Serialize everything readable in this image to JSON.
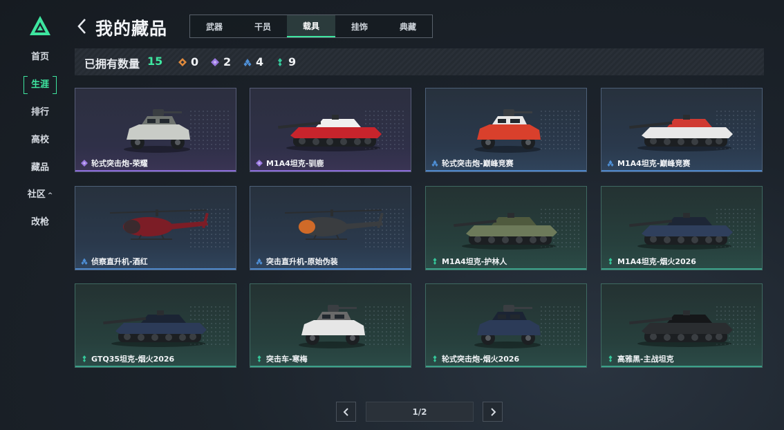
{
  "sidebar": {
    "logo": "game-logo",
    "items": [
      {
        "label": "首页",
        "active": false
      },
      {
        "label": "生涯",
        "active": true
      },
      {
        "label": "排行",
        "active": false
      },
      {
        "label": "高校",
        "active": false
      },
      {
        "label": "藏品",
        "active": false
      },
      {
        "label": "社区",
        "active": false,
        "caret": "^"
      },
      {
        "label": "改枪",
        "active": false
      }
    ]
  },
  "header": {
    "title": "我的藏品",
    "tabs": [
      {
        "label": "武器",
        "active": false
      },
      {
        "label": "干员",
        "active": false
      },
      {
        "label": "载具",
        "active": true
      },
      {
        "label": "挂饰",
        "active": false
      },
      {
        "label": "典藏",
        "active": false
      }
    ]
  },
  "summary": {
    "label": "已拥有数量",
    "total": "15",
    "rarities": [
      {
        "icon": "orange-diamond-icon",
        "color": "#e08a3c",
        "count": "0"
      },
      {
        "icon": "purple-diamond-icon",
        "color": "#9a78e0",
        "count": "2"
      },
      {
        "icon": "blue-diamond-icon",
        "color": "#4e8fd6",
        "count": "4"
      },
      {
        "icon": "green-diamond-icon",
        "color": "#35c79a",
        "count": "9"
      }
    ]
  },
  "cards": [
    {
      "name": "轮式突击炮-荣耀",
      "rarity": "purple",
      "vehicle": "armored-car"
    },
    {
      "name": "M1A4坦克-驯鹿",
      "rarity": "purple",
      "vehicle": "tank"
    },
    {
      "name": "轮式突击炮-巅峰竞赛",
      "rarity": "blue",
      "vehicle": "armored-car"
    },
    {
      "name": "M1A4坦克-巅峰竞赛",
      "rarity": "blue",
      "vehicle": "tank"
    },
    {
      "name": "侦察直升机-酒红",
      "rarity": "blue",
      "vehicle": "helicopter"
    },
    {
      "name": "突击直升机-原始伪装",
      "rarity": "blue",
      "vehicle": "helicopter"
    },
    {
      "name": "M1A4坦克-护林人",
      "rarity": "green",
      "vehicle": "tank"
    },
    {
      "name": "M1A4坦克-烟火2026",
      "rarity": "green",
      "vehicle": "tank"
    },
    {
      "name": "GTQ35坦克-烟火2026",
      "rarity": "green",
      "vehicle": "tank"
    },
    {
      "name": "突击车-寒梅",
      "rarity": "green",
      "vehicle": "armored-car"
    },
    {
      "name": "轮式突击炮-烟火2026",
      "rarity": "green",
      "vehicle": "armored-car"
    },
    {
      "name": "高雅黑-主战坦克",
      "rarity": "green",
      "vehicle": "tank"
    }
  ],
  "colors": {
    "accent": "#3ee6a0",
    "purple": "#9a78e0",
    "blue": "#4e8fd6",
    "green": "#35c79a",
    "orange": "#e08a3c"
  },
  "pagination": {
    "indicator": "1/2",
    "prev_icon": "chevron-left-icon",
    "next_icon": "chevron-right-icon"
  }
}
